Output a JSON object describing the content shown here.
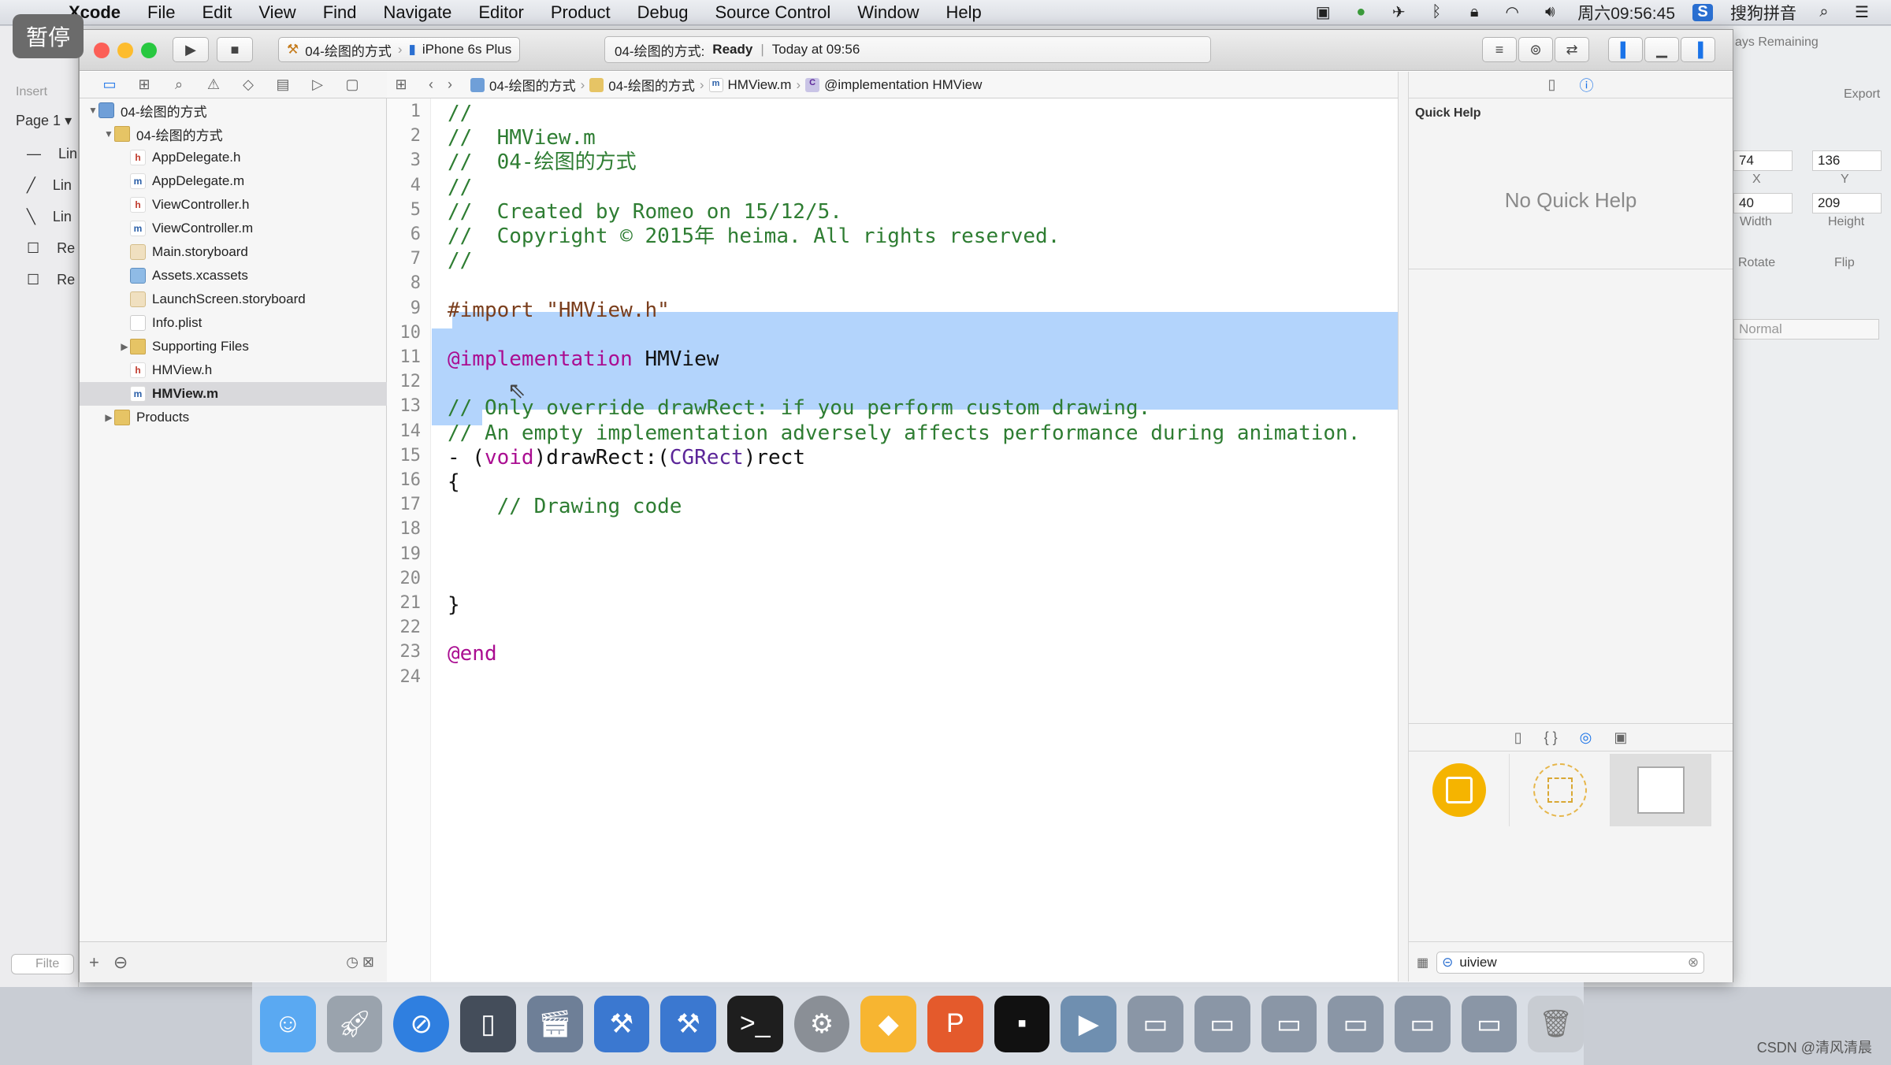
{
  "menubar": {
    "app": "Xcode",
    "items": [
      "File",
      "Edit",
      "View",
      "Find",
      "Navigate",
      "Editor",
      "Product",
      "Debug",
      "Source Control",
      "Window",
      "Help"
    ],
    "clock": "周六09:56:45",
    "input_method": "搜狗拼音"
  },
  "overlay": {
    "pause_label": "暂停"
  },
  "background_app": {
    "insert_label": "Insert",
    "page_label": "Page 1",
    "layers": [
      "Lin",
      "Lin",
      "Lin",
      "Re",
      "Re"
    ],
    "filter_placeholder": "Filte",
    "right_panel": {
      "remaining": "ays Remaining",
      "export_label": "Export",
      "x_value": "74",
      "y_value": "136",
      "x_label": "X",
      "y_label": "Y",
      "width_value": "40",
      "height_value": "209",
      "width_label": "Width",
      "height_label": "Height",
      "rotate_label": "Rotate",
      "flip_label": "Flip",
      "blend_mode": "Normal"
    }
  },
  "toolbar": {
    "scheme": "04-绘图的方式",
    "device": "iPhone 6s Plus",
    "activity_project": "04-绘图的方式:",
    "activity_status": "Ready",
    "activity_time": "Today at 09:56"
  },
  "jumpbar": {
    "items": [
      "04-绘图的方式",
      "04-绘图的方式",
      "HMView.m",
      "@implementation HMView"
    ]
  },
  "navigator": {
    "tree": [
      {
        "label": "04-绘图的方式",
        "icon": "proj",
        "depth": 0,
        "disclosure": "▼"
      },
      {
        "label": "04-绘图的方式",
        "icon": "folder",
        "depth": 1,
        "disclosure": "▼"
      },
      {
        "label": "AppDelegate.h",
        "icon": "h",
        "depth": 2,
        "disclosure": ""
      },
      {
        "label": "AppDelegate.m",
        "icon": "m",
        "depth": 2,
        "disclosure": ""
      },
      {
        "label": "ViewController.h",
        "icon": "h",
        "depth": 2,
        "disclosure": ""
      },
      {
        "label": "ViewController.m",
        "icon": "m",
        "depth": 2,
        "disclosure": ""
      },
      {
        "label": "Main.storyboard",
        "icon": "sb",
        "depth": 2,
        "disclosure": ""
      },
      {
        "label": "Assets.xcassets",
        "icon": "xa",
        "depth": 2,
        "disclosure": ""
      },
      {
        "label": "LaunchScreen.storyboard",
        "icon": "sb",
        "depth": 2,
        "disclosure": ""
      },
      {
        "label": "Info.plist",
        "icon": "pl",
        "depth": 2,
        "disclosure": ""
      },
      {
        "label": "Supporting Files",
        "icon": "folder",
        "depth": 2,
        "disclosure": "▶"
      },
      {
        "label": "HMView.h",
        "icon": "h",
        "depth": 2,
        "disclosure": ""
      },
      {
        "label": "HMView.m",
        "icon": "m",
        "depth": 2,
        "disclosure": "",
        "selected": true
      },
      {
        "label": "Products",
        "icon": "folder",
        "depth": 1,
        "disclosure": "▶"
      }
    ]
  },
  "editor": {
    "line_numbers": [
      "1",
      "2",
      "3",
      "4",
      "5",
      "6",
      "7",
      "8",
      "9",
      "10",
      "11",
      "12",
      "13",
      "14",
      "15",
      "16",
      "17",
      "18",
      "19",
      "20",
      "21",
      "22",
      "23",
      "24"
    ],
    "lines": [
      [
        {
          "t": "//",
          "c": "com"
        }
      ],
      [
        {
          "t": "//  HMView.m",
          "c": "com"
        }
      ],
      [
        {
          "t": "//  04-绘图的方式",
          "c": "com"
        }
      ],
      [
        {
          "t": "//",
          "c": "com"
        }
      ],
      [
        {
          "t": "//  Created by Romeo on 15/12/5.",
          "c": "com"
        }
      ],
      [
        {
          "t": "//  Copyright © 2015年 heima. All rights reserved.",
          "c": "com"
        }
      ],
      [
        {
          "t": "//",
          "c": "com"
        }
      ],
      [],
      [
        {
          "t": "#import ",
          "c": "pre"
        },
        {
          "t": "\"HMView.h\"",
          "c": "pre"
        }
      ],
      [],
      [
        {
          "t": "@implementation",
          "c": "kw"
        },
        {
          "t": " HMView",
          "c": "pl"
        }
      ],
      [],
      [
        {
          "t": "// Only override drawRect: if you perform custom drawing.",
          "c": "com"
        }
      ],
      [
        {
          "t": "// An empty implementation adversely affects performance during animation.",
          "c": "com"
        }
      ],
      [
        {
          "t": "- (",
          "c": "pl"
        },
        {
          "t": "void",
          "c": "kw"
        },
        {
          "t": ")drawRect:(",
          "c": "pl"
        },
        {
          "t": "CGRect",
          "c": "type"
        },
        {
          "t": ")rect",
          "c": "pl"
        }
      ],
      [
        {
          "t": "{",
          "c": "pl"
        }
      ],
      [
        {
          "t": "    // Drawing code",
          "c": "com"
        }
      ],
      [],
      [],
      [],
      [
        {
          "t": "}",
          "c": "pl"
        }
      ],
      [],
      [
        {
          "t": "@end",
          "c": "kw"
        }
      ],
      []
    ]
  },
  "inspector": {
    "quick_help_title": "Quick Help",
    "quick_help_empty": "No Quick Help",
    "library_search": "uiview"
  },
  "watermark": "CSDN @清风清晨",
  "colors": {
    "selection": "#b3d4fc",
    "comment": "#2e7d32",
    "keyword": "#aa0d91",
    "preprocessor": "#7a3e1d",
    "type": "#5c2699"
  }
}
